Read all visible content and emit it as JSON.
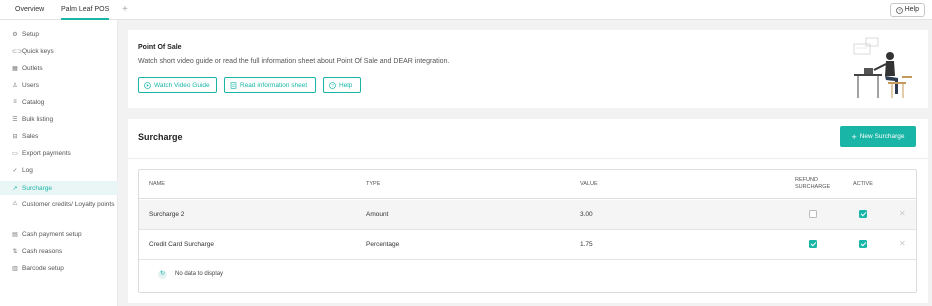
{
  "tabs": [
    {
      "label": "Overview"
    },
    {
      "label": "Palm Leaf POS"
    }
  ],
  "tab_add_glyph": "+",
  "help_button": {
    "label": "Help",
    "icon": "help-circle-icon"
  },
  "sidebar": {
    "items": [
      {
        "label": "Setup",
        "icon": "gear-icon"
      },
      {
        "label": "Quick keys",
        "icon": "link-icon"
      },
      {
        "label": "Outlets",
        "icon": "grid-icon"
      },
      {
        "label": "Users",
        "icon": "users-icon"
      },
      {
        "label": "Catalog",
        "icon": "list-icon"
      },
      {
        "label": "Bulk listing",
        "icon": "bulk-icon"
      },
      {
        "label": "Sales",
        "icon": "sales-icon"
      },
      {
        "label": "Export payments",
        "icon": "export-icon"
      },
      {
        "label": "Log",
        "icon": "check-icon"
      },
      {
        "label": "Surcharge",
        "icon": "trend-icon",
        "active": true
      },
      {
        "label": "Customer credits/ Loyalty points",
        "icon": "loyalty-icon"
      },
      {
        "label": "Cash payment setup",
        "icon": "cash-icon"
      },
      {
        "label": "Cash reasons",
        "icon": "reasons-icon"
      },
      {
        "label": "Barcode setup",
        "icon": "barcode-icon"
      }
    ]
  },
  "pos_card": {
    "title": "Point Of Sale",
    "description": "Watch short video guide or read the full information sheet about Point Of Sale and DEAR integration.",
    "buttons": {
      "video": "Watch Video Guide",
      "sheet": "Read information sheet",
      "help": "Help"
    }
  },
  "surcharge": {
    "title": "Surcharge",
    "new_button": "New Surcharge",
    "columns": {
      "name": "NAME",
      "type": "TYPE",
      "value": "VALUE",
      "refund": "REFUND SURCHARGE",
      "active": "ACTIVE"
    },
    "rows": [
      {
        "name": "Surcharge 2",
        "type": "Amount",
        "value": "3.00",
        "refund": false,
        "active": true
      },
      {
        "name": "Credit Card Surcharge",
        "type": "Percentage",
        "value": "1.75",
        "refund": true,
        "active": true
      }
    ],
    "no_data": "No data to display"
  },
  "colors": {
    "accent": "#19b5a6"
  }
}
